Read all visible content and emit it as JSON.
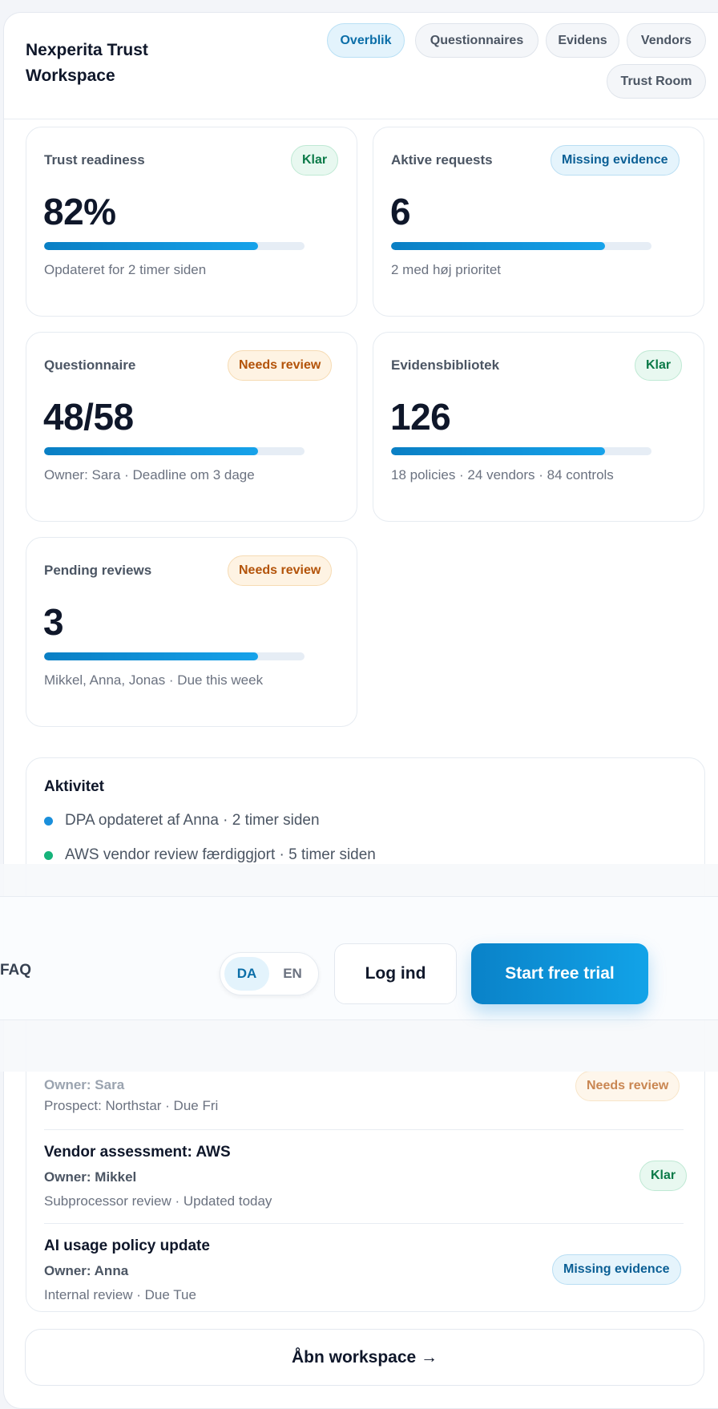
{
  "header": {
    "brand": "Nexperita Trust Workspace",
    "tabs": [
      "Overblik",
      "Questionnaires",
      "Evidens",
      "Vendors",
      "Trust Room"
    ]
  },
  "stats": [
    {
      "title": "Trust readiness",
      "badge": "Klar",
      "value": "82%",
      "progress": 0.82,
      "sub": "Opdateret for 2 timer siden"
    },
    {
      "title": "Aktive requests",
      "badge": "Missing evidence",
      "value": "6",
      "progress": 0.82,
      "sub": "2 med høj prioritet"
    },
    {
      "title": "Questionnaire",
      "badge": "Needs review",
      "value": "48/58",
      "progress": 0.82,
      "sub": "Owner: Sara · Deadline om 3 dage"
    },
    {
      "title": "Evidensbibliotek",
      "badge": "Klar",
      "value": "126",
      "progress": 0.82,
      "sub": "18 policies · 24 vendors · 84 controls"
    },
    {
      "title": "Pending reviews",
      "badge": "Needs review",
      "value": "3",
      "progress": 0.82,
      "sub": "Mikkel, Anna, Jonas · Due this week"
    }
  ],
  "activity": {
    "title": "Aktivitet",
    "items": [
      {
        "text": "DPA opdateret af Anna · 2 timer siden",
        "color": "#1a8fdb"
      },
      {
        "text": "AWS vendor review færdiggjort · 5 timer siden",
        "color": "#16b37a"
      }
    ]
  },
  "nav": {
    "faq": "FAQ",
    "lang_da": "DA",
    "lang_en": "EN",
    "login": "Log ind",
    "trial": "Start free trial"
  },
  "tasks": {
    "partial": {
      "owner": "Owner: Sara",
      "meta": "Prospect: Northstar · Due Fri",
      "badge": "Needs review"
    },
    "items": [
      {
        "name": "Vendor assessment: AWS",
        "owner": "Owner: Mikkel",
        "meta": "Subprocessor review · Updated today",
        "badge": "Klar"
      },
      {
        "name": "AI usage policy update",
        "owner": "Owner: Anna",
        "meta": "Internal review · Due Tue",
        "badge": "Missing evidence"
      }
    ]
  },
  "footer": {
    "open_workspace": "Åbn workspace →"
  },
  "colors": {
    "accent": "#0a82c8",
    "green": "#0b7a48",
    "orange": "#b35309"
  }
}
